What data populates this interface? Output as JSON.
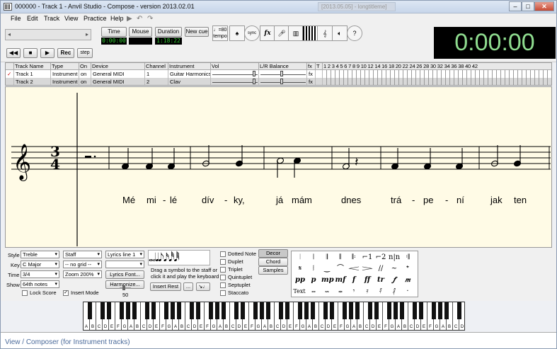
{
  "window": {
    "title": "000000 - Track 1 - Anvil Studio - Compose - version 2013.02.01",
    "ghost_tab": "[2013.05.05] - longtitleme]"
  },
  "menu": [
    {
      "label": "File",
      "key": "F"
    },
    {
      "label": "Edit",
      "key": "E"
    },
    {
      "label": "Track",
      "key": "T"
    },
    {
      "label": "View",
      "key": "V"
    },
    {
      "label": "Practice",
      "key": "P"
    },
    {
      "label": "Help",
      "key": "H"
    }
  ],
  "toolbar": {
    "time_label": "Time",
    "mouse_label": "Mouse",
    "duration_label": "Duration",
    "new_cue_label": "New cue",
    "time_value": "0:00:00",
    "mouse_value": "",
    "duration_value": "1:18:22",
    "rec_label": "Rec",
    "step_label": "step",
    "tempo_value": "♩=80",
    "tempo_label": "tempo",
    "sync_label": "sync",
    "fx_label": "fx",
    "help_label": "?",
    "clock": "0:00:00"
  },
  "tracks": {
    "columns": [
      "",
      "Track Name",
      "Type",
      "On",
      "Device",
      "Channel",
      "Instrument",
      "Vol",
      "L/R Balance",
      "fx",
      "T"
    ],
    "ruler": "1 2 3 4 5 6 7 8 9 10 12 14 16 18 20 22 24 26 28 30 32 34 36 38 40 42",
    "rows": [
      {
        "check": "✓",
        "name": "Track 1",
        "type": "Instrument",
        "on": "on",
        "device": "General MIDI",
        "channel": "1",
        "instrument": "Guitar Harmonics",
        "fx": "fx"
      },
      {
        "check": "",
        "name": "Track 2",
        "type": "Instrument",
        "on": "on",
        "device": "General MIDI",
        "channel": "2",
        "instrument": "Clav",
        "fx": "fx"
      }
    ]
  },
  "score": {
    "time_sig_top": "3",
    "time_sig_bottom": "4",
    "lyrics": [
      "Mé",
      "mi",
      "-",
      "lé",
      "dív",
      "-",
      "ky,",
      "já",
      "mám",
      "dnes",
      "trá",
      "-",
      "pe",
      "-",
      "ní",
      "jak",
      "ten"
    ]
  },
  "palette": {
    "style_label": "Style",
    "style_value": "Treble",
    "staff_value": "Staff",
    "lyrics_line_value": "Lyrics line 1",
    "key_label": "Key",
    "key_value": "C Major",
    "grid_value": "-- no grid --",
    "time_label": "Time",
    "time_value": "3/4",
    "zoom_value": "Zoom 200%",
    "lyrics_font_label": "Lyrics Font...",
    "show_label": "Show",
    "show_value": "64th notes",
    "harmonize_label": "Harmonize...",
    "lock_score_label": "Lock Score",
    "insert_mode_label": "Insert Mode",
    "insert_rest_label": "Insert Rest",
    "dots_label": "...",
    "hint": "Drag a symbol to the staff or click it and play the keyboard",
    "slider_value": "50",
    "dotted_note": "Dotted Note",
    "duplet": "Duplet",
    "triplet": "Triplet",
    "quintuplet": "Quintuplet",
    "septuplet": "Septuplet",
    "staccato": "Staccato",
    "tab_decor": "Decor",
    "tab_chord": "Chord",
    "tab_samples": "Samples",
    "sym_row1": [
      "𝄀",
      "𝄁",
      "𝄂",
      "𝄃",
      "𝄆",
      "⌐1",
      "⌐2",
      "n|n",
      "𝄇"
    ],
    "sym_row2": [
      "𝄋",
      "𝆃",
      "‿",
      "⌒",
      "𝆒",
      "𝆓",
      "//",
      "~",
      "𝄌"
    ],
    "sym_row3": [
      "pp",
      "p",
      "mp",
      "mf",
      "f",
      "ff",
      "tr",
      "𝆑",
      "𝆐"
    ],
    "text_label": "Text",
    "sym_row4": [
      "𝆗",
      "𝆘",
      "𝆙",
      "𝄾",
      "𝄿",
      "𝅀",
      "𝅁",
      "·"
    ]
  },
  "piano": {
    "letters": [
      "A",
      "B",
      "C",
      "D",
      "E",
      "F",
      "G"
    ]
  },
  "status": {
    "text": "View / Composer (for Instrument tracks)"
  }
}
